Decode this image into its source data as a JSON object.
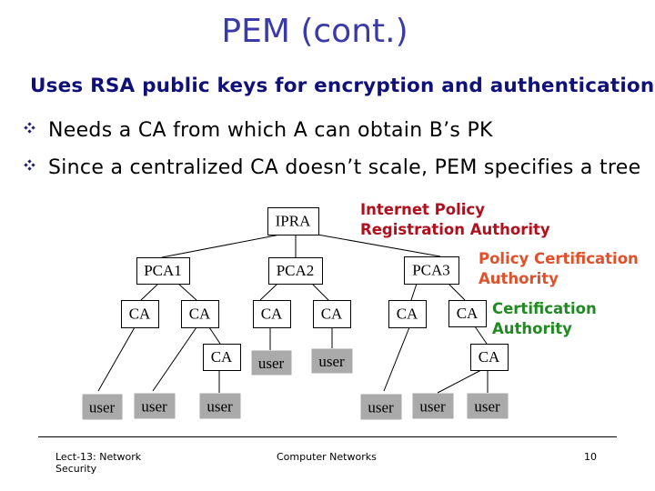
{
  "slide": {
    "title": "PEM (cont.)",
    "subtitle": "Uses RSA public keys for encryption and authentication",
    "bullets": [
      {
        "icon": "diamond-bullet-icon",
        "text": "Needs a CA from which A can obtain B’s PK"
      },
      {
        "icon": "diamond-bullet-icon",
        "text": "Since a centralized CA doesn’t scale, PEM specifies a tree"
      }
    ]
  },
  "diagram": {
    "annotations": {
      "ipra": {
        "line1": "Internet Policy",
        "line2": "Registration Authority",
        "color": "#b0101e"
      },
      "pca": {
        "line1": "Policy Certification",
        "line2": "Authority",
        "color": "#e0502a"
      },
      "ca": {
        "line1": "Certification",
        "line2": "Authority",
        "color": "#228a22"
      }
    },
    "nodes": [
      {
        "id": "ipra",
        "label": "IPRA",
        "kind": "authority"
      },
      {
        "id": "pca1",
        "label": "PCA1",
        "kind": "authority"
      },
      {
        "id": "pca2",
        "label": "PCA2",
        "kind": "authority"
      },
      {
        "id": "pca3",
        "label": "PCA3",
        "kind": "authority"
      },
      {
        "id": "ca1",
        "label": "CA",
        "kind": "authority"
      },
      {
        "id": "ca2",
        "label": "CA",
        "kind": "authority"
      },
      {
        "id": "ca3",
        "label": "CA",
        "kind": "authority"
      },
      {
        "id": "ca4",
        "label": "CA",
        "kind": "authority"
      },
      {
        "id": "ca5",
        "label": "CA",
        "kind": "authority"
      },
      {
        "id": "ca6",
        "label": "CA",
        "kind": "authority"
      },
      {
        "id": "ca2a",
        "label": "CA",
        "kind": "authority"
      },
      {
        "id": "ca6a",
        "label": "CA",
        "kind": "authority"
      },
      {
        "id": "u1",
        "label": "user",
        "kind": "user"
      },
      {
        "id": "u2",
        "label": "user",
        "kind": "user"
      },
      {
        "id": "u3",
        "label": "user",
        "kind": "user"
      },
      {
        "id": "u4",
        "label": "user",
        "kind": "user"
      },
      {
        "id": "u5",
        "label": "user",
        "kind": "user"
      },
      {
        "id": "u6",
        "label": "user",
        "kind": "user"
      },
      {
        "id": "u7",
        "label": "user",
        "kind": "user"
      },
      {
        "id": "u8",
        "label": "user",
        "kind": "user"
      }
    ],
    "edges": [
      [
        "ipra",
        "pca1"
      ],
      [
        "ipra",
        "pca2"
      ],
      [
        "ipra",
        "pca3"
      ],
      [
        "pca1",
        "ca1"
      ],
      [
        "pca1",
        "ca2"
      ],
      [
        "pca2",
        "ca3"
      ],
      [
        "pca2",
        "ca4"
      ],
      [
        "pca3",
        "ca5"
      ],
      [
        "pca3",
        "ca6"
      ],
      [
        "ca1",
        "u1"
      ],
      [
        "ca2",
        "u2"
      ],
      [
        "ca2",
        "ca2a"
      ],
      [
        "ca2a",
        "u3"
      ],
      [
        "ca3",
        "u4"
      ],
      [
        "ca4",
        "u5"
      ],
      [
        "ca5",
        "u6"
      ],
      [
        "ca6",
        "ca6a"
      ],
      [
        "ca6a",
        "u7"
      ],
      [
        "ca6a",
        "u8"
      ]
    ]
  },
  "footer": {
    "left": "Lect-13: Network Security",
    "center": "Computer Networks",
    "page_number": "10"
  }
}
